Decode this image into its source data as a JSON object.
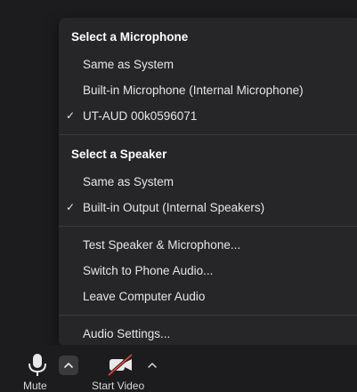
{
  "menu": {
    "microphone_header": "Select a Microphone",
    "microphones": [
      {
        "label": "Same as System",
        "checked": false
      },
      {
        "label": "Built-in Microphone (Internal Microphone)",
        "checked": false
      },
      {
        "label": "UT-AUD 00k0596071",
        "checked": true
      }
    ],
    "speaker_header": "Select a Speaker",
    "speakers": [
      {
        "label": "Same as System",
        "checked": false
      },
      {
        "label": "Built-in Output (Internal Speakers)",
        "checked": true
      }
    ],
    "actions": [
      {
        "label": "Test Speaker & Microphone..."
      },
      {
        "label": "Switch to Phone Audio..."
      },
      {
        "label": "Leave Computer Audio"
      }
    ],
    "settings_label": "Audio Settings...",
    "check_glyph": "✓"
  },
  "toolbar": {
    "mute_label": "Mute",
    "video_label": "Start Video"
  },
  "colors": {
    "menu_bg": "#262629",
    "page_bg": "#1c1c1e",
    "video_off_slash": "#e0453a"
  },
  "icons": {
    "microphone": "microphone-icon",
    "audio_options": "chevron-up-icon",
    "video": "video-camera-off-icon",
    "video_options": "chevron-up-icon",
    "check": "checkmark-icon"
  }
}
